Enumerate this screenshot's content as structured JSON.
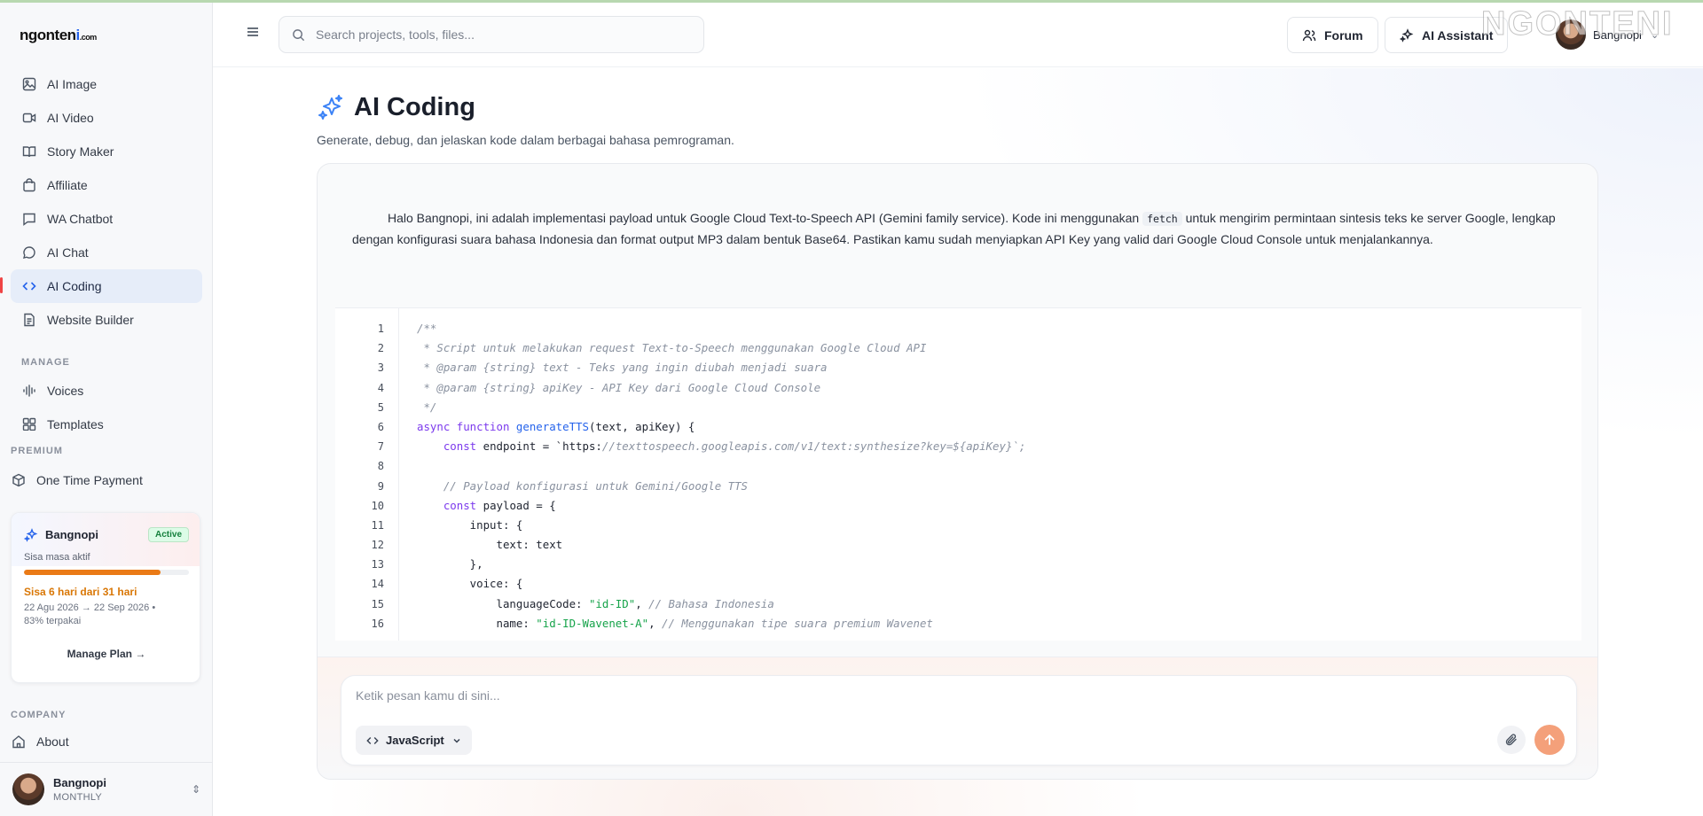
{
  "brand": {
    "logo_main": "ngonten",
    "logo_accent": "i",
    "logo_suffix": ".com",
    "watermark": "NGONTENI"
  },
  "sidebar": {
    "items": [
      {
        "label": "AI Image",
        "icon": "image-icon"
      },
      {
        "label": "AI Video",
        "icon": "video-icon"
      },
      {
        "label": "Story Maker",
        "icon": "book-icon"
      },
      {
        "label": "Affiliate",
        "icon": "shopping-bag-icon"
      },
      {
        "label": "WA Chatbot",
        "icon": "chat-square-icon"
      },
      {
        "label": "AI Chat",
        "icon": "chat-bubble-icon"
      },
      {
        "label": "AI Coding",
        "icon": "code-icon",
        "active": true
      },
      {
        "label": "Website Builder",
        "icon": "document-icon"
      }
    ],
    "manage_label": "MANAGE",
    "manage_items": [
      {
        "label": "Voices",
        "icon": "waveform-icon"
      },
      {
        "label": "Templates",
        "icon": "grid-icon"
      }
    ],
    "premium_label": "PREMIUM",
    "premium_item": {
      "label": "One Time Payment",
      "icon": "package-icon"
    },
    "plan": {
      "name": "Bangnopi",
      "status": "Active",
      "subtitle": "Sisa masa aktif",
      "progress_percent": 83,
      "remaining": "Sisa 6 hari dari 31 hari",
      "dates": "22 Agu 2026 → 22 Sep 2026 •",
      "used": "83% terpakai",
      "manage_label": "Manage Plan →"
    },
    "company_label": "COMPANY",
    "company_items": [
      {
        "label": "About",
        "icon": "home-icon"
      }
    ],
    "user": {
      "name": "Bangnopi",
      "plan": "MONTHLY"
    }
  },
  "topbar": {
    "search_placeholder": "Search projects, tools, files...",
    "forum_label": "Forum",
    "assistant_label": "AI Assistant",
    "user_name": "Bangnopi"
  },
  "page": {
    "title": "AI Coding",
    "subtitle": "Generate, debug, dan jelaskan kode dalam berbagai bahasa pemrograman."
  },
  "chat": {
    "message_before": "Halo Bangnopi, ini adalah implementasi payload untuk Google Cloud Text-to-Speech API (Gemini family service). Kode ini menggunakan ",
    "message_code": "fetch",
    "message_after": " untuk mengirim permintaan sintesis teks ke server Google, lengkap dengan konfigurasi suara bahasa Indonesia dan format output MP3 dalam bentuk Base64. Pastikan kamu sudah menyiapkan API Key yang valid dari Google Cloud Console untuk menjalankannya.",
    "code_lines": [
      [
        [
          "com",
          "/**"
        ]
      ],
      [
        [
          "com",
          " * Script untuk melakukan request Text-to-Speech menggunakan Google Cloud API"
        ]
      ],
      [
        [
          "com",
          " * @param {string} text - Teks yang ingin diubah menjadi suara"
        ]
      ],
      [
        [
          "com",
          " * @param {string} apiKey - API Key dari Google Cloud Console"
        ]
      ],
      [
        [
          "com",
          " */"
        ]
      ],
      [
        [
          "kw",
          "async function "
        ],
        [
          "fn",
          "generateTTS"
        ],
        [
          "",
          "(text, apiKey) {"
        ]
      ],
      [
        [
          "",
          "    "
        ],
        [
          "kw",
          "const"
        ],
        [
          "",
          " endpoint = `https:"
        ],
        [
          "tpl",
          "//texttospeech.googleapis.com/v1/text:synthesize?key=${apiKey}`;"
        ]
      ],
      [
        [
          "",
          ""
        ]
      ],
      [
        [
          "",
          "    "
        ],
        [
          "tpl",
          "// Payload konfigurasi untuk Gemini/Google TTS"
        ]
      ],
      [
        [
          "",
          "    "
        ],
        [
          "kw",
          "const"
        ],
        [
          "",
          " payload = {"
        ]
      ],
      [
        [
          "",
          "        input: {"
        ]
      ],
      [
        [
          "",
          "            text: text"
        ]
      ],
      [
        [
          "",
          "        },"
        ]
      ],
      [
        [
          "",
          "        voice: {"
        ]
      ],
      [
        [
          "",
          "            languageCode: "
        ],
        [
          "str",
          "\"id-ID\""
        ],
        [
          "",
          ", "
        ],
        [
          "tpl",
          "// Bahasa Indonesia"
        ]
      ],
      [
        [
          "",
          "            name: "
        ],
        [
          "str",
          "\"id-ID-Wavenet-A\""
        ],
        [
          "",
          ", "
        ],
        [
          "tpl",
          "// Menggunakan tipe suara premium Wavenet"
        ]
      ]
    ]
  },
  "composer": {
    "placeholder": "Ketik pesan kamu di sini...",
    "language": "JavaScript"
  },
  "colors": {
    "accent": "#2563eb",
    "active_bg": "#e6edf9",
    "send": "#f4a07a",
    "progress": "#ea7a16"
  }
}
